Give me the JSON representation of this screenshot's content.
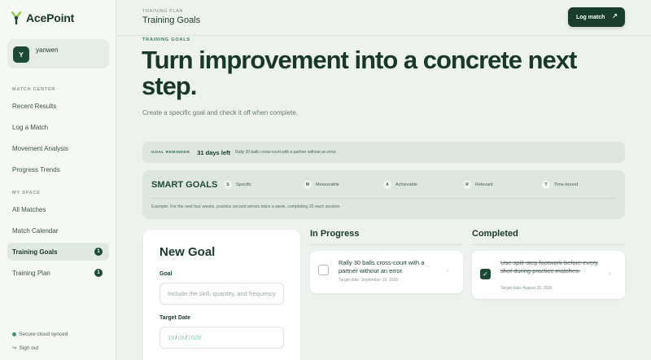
{
  "brand": {
    "name": "AcePoint"
  },
  "user": {
    "initial": "Y",
    "name": "yanwen"
  },
  "sidebar": {
    "section_match": "MATCH CENTER",
    "match_items": [
      {
        "label": "Recent Results"
      },
      {
        "label": "Log a Match"
      },
      {
        "label": "Movement Analysis"
      },
      {
        "label": "Progress Trends"
      }
    ],
    "section_space": "MY SPACE",
    "space_items": [
      {
        "label": "All Matches"
      },
      {
        "label": "Match Calendar"
      },
      {
        "label": "Training Goals",
        "badge": "1"
      },
      {
        "label": "Training Plan",
        "badge": "1"
      }
    ],
    "sync_status": "Secure cloud synced",
    "sign_out": "Sign out"
  },
  "header": {
    "breadcrumb": "TRAINING PLAN",
    "title": "Training Goals",
    "log_button": "Log match",
    "log_icon": "arrow-up-right-icon"
  },
  "hero": {
    "eyebrow": "TRAINING GOALS",
    "title": "Turn improvement into a concrete next step.",
    "subtitle": "Create a specific goal and check it off when complete."
  },
  "reminder": {
    "label": "GOAL REMINDER",
    "days": "31 days left",
    "text": "Rally 30 balls cross-court with a partner without an error."
  },
  "smart": {
    "title": "SMART GOALS",
    "items": [
      {
        "letter": "S",
        "label": "Specific"
      },
      {
        "letter": "M",
        "label": "Measurable"
      },
      {
        "letter": "A",
        "label": "Achievable"
      },
      {
        "letter": "R",
        "label": "Relevant"
      },
      {
        "letter": "T",
        "label": "Time-bound"
      }
    ],
    "example": "Example: For the next four weeks, practice second serves twice a week, completing 20 each session."
  },
  "new_goal": {
    "title": "New Goal",
    "goal_label": "Goal",
    "goal_placeholder": "Include the skill, quantity, and frequency",
    "date_label": "Target Date",
    "date_day": "19",
    "date_month": "08",
    "date_year": "2026"
  },
  "in_progress": {
    "title": "In Progress",
    "tasks": [
      {
        "text": "Rally 30 balls cross-court with a partner without an error.",
        "date": "Target date: September 19, 2026"
      }
    ]
  },
  "completed": {
    "title": "Completed",
    "tasks": [
      {
        "text": "Use split-step footwork before every shot during practice matches.",
        "date": "Target date: August 20, 2026"
      }
    ]
  },
  "colors": {
    "primary": "#173d2d",
    "accent": "#3a9a68",
    "background": "#eef2ee"
  }
}
